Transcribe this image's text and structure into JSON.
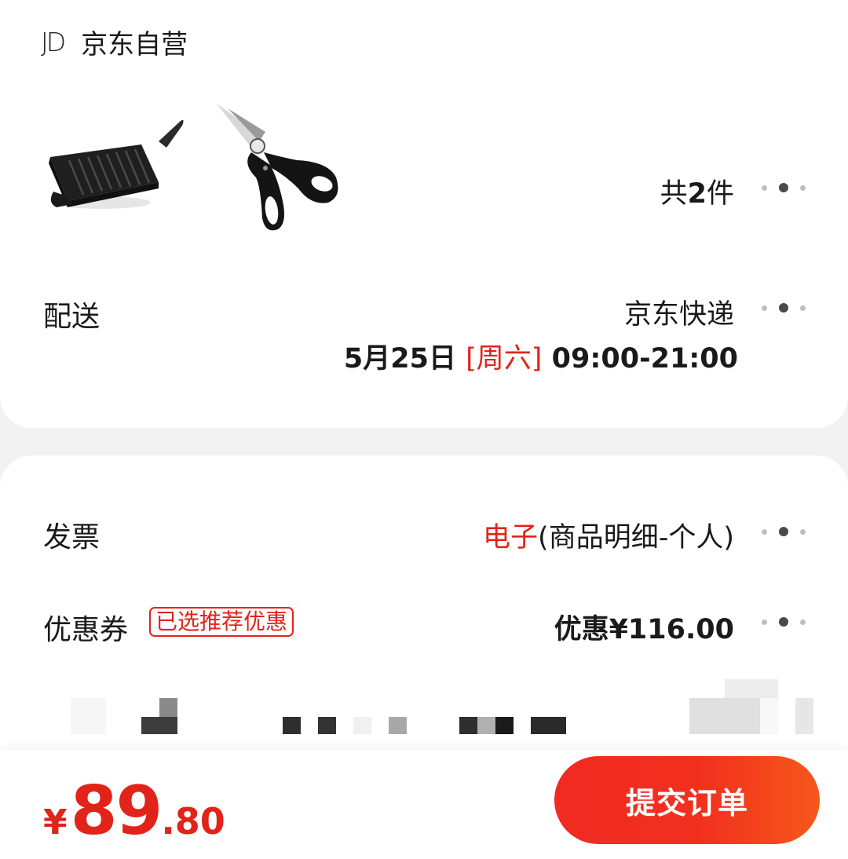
{
  "shop": {
    "logo_text": "JD",
    "name": "京东自营"
  },
  "products": {
    "items": [
      {
        "name": "grill-pan-icon"
      },
      {
        "name": "scissors-icon"
      }
    ],
    "count_prefix": "共",
    "count_number": "2",
    "count_suffix": "件"
  },
  "delivery": {
    "label": "配送",
    "method": "京东快递",
    "date": "5月25日",
    "weekday": "[周六]",
    "time_range": "09:00-21:00"
  },
  "invoice": {
    "label": "发票",
    "type": "电子",
    "detail": "(商品明细-个人)"
  },
  "coupon": {
    "label": "优惠券",
    "tag": "已选推荐优惠",
    "value": "优惠¥116.00"
  },
  "total": {
    "currency": "¥",
    "integer": "89",
    "decimal": ".80"
  },
  "submit_label": "提交订单",
  "colors": {
    "accent": "#e2231a",
    "background": "#f2f2f2",
    "card": "#ffffff"
  }
}
